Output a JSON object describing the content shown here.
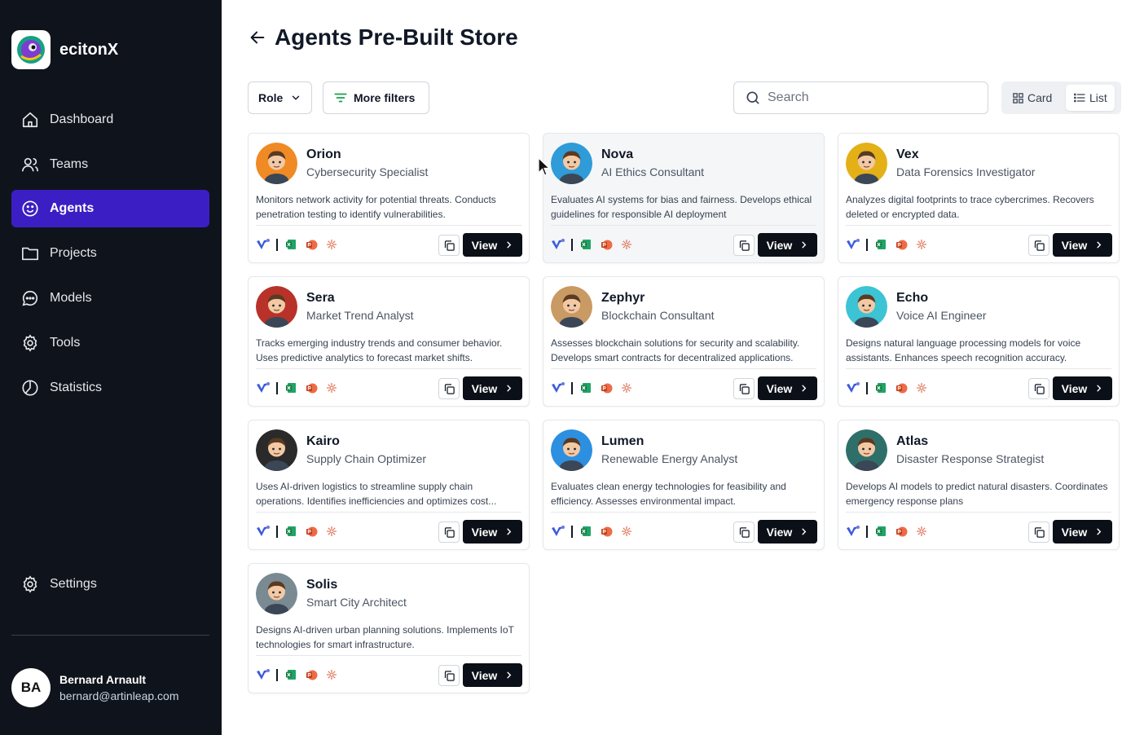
{
  "app": {
    "name": "ecitonX"
  },
  "sidebar": {
    "items": [
      {
        "label": "Dashboard",
        "icon": "home-icon"
      },
      {
        "label": "Teams",
        "icon": "users-icon"
      },
      {
        "label": "Agents",
        "icon": "smile-icon",
        "active": true
      },
      {
        "label": "Projects",
        "icon": "folder-icon"
      },
      {
        "label": "Models",
        "icon": "chat-icon"
      },
      {
        "label": "Tools",
        "icon": "gear-icon"
      },
      {
        "label": "Statistics",
        "icon": "pie-chart-icon"
      }
    ],
    "settings_label": "Settings"
  },
  "user": {
    "initials": "BA",
    "name": "Bernard Arnault",
    "email": "bernard@artinleap.com"
  },
  "page": {
    "title": "Agents Pre-Built Store"
  },
  "filters": {
    "role_label": "Role",
    "more_filters_label": "More filters"
  },
  "search": {
    "placeholder": "Search"
  },
  "view_toggle": {
    "card_label": "Card",
    "list_label": "List",
    "selected": "List"
  },
  "card_action": {
    "view_label": "View"
  },
  "colors": {
    "accent": "#3b1fc4",
    "sidebar_bg": "#0f141c",
    "view_button": "#0b0f17"
  },
  "agents": [
    {
      "name": "Orion",
      "role": "Cybersecurity Specialist",
      "description": "Monitors network activity for potential threats. Conducts penetration testing to identify vulnerabilities.",
      "avatar_color": "#f08a24"
    },
    {
      "name": "Nova",
      "role": "AI Ethics Consultant",
      "description": "Evaluates AI systems for bias and fairness. Develops ethical guidelines for responsible AI deployment",
      "avatar_color": "#2f9bd8"
    },
    {
      "name": "Vex",
      "role": "Data Forensics Investigator",
      "description": "Analyzes digital footprints to trace cybercrimes. Recovers deleted or encrypted data.",
      "avatar_color": "#e3b117"
    },
    {
      "name": "Sera",
      "role": "Market Trend Analyst",
      "description": "Tracks emerging industry trends and consumer behavior. Uses predictive analytics to forecast market shifts.",
      "avatar_color": "#b8322a"
    },
    {
      "name": "Zephyr",
      "role": "Blockchain Consultant",
      "description": "Assesses blockchain solutions for security and scalability. Develops smart contracts for decentralized applications.",
      "avatar_color": "#c99a63"
    },
    {
      "name": "Echo",
      "role": "Voice AI Engineer",
      "description": "Designs natural language processing models for voice assistants. Enhances speech recognition accuracy.",
      "avatar_color": "#3cc3d4"
    },
    {
      "name": "Kairo",
      "role": "Supply Chain Optimizer",
      "description": "Uses AI-driven logistics to streamline supply chain operations. Identifies inefficiencies and optimizes cost...",
      "avatar_color": "#2a2a2a"
    },
    {
      "name": "Lumen",
      "role": "Renewable Energy Analyst",
      "description": "Evaluates clean energy technologies for feasibility and efficiency. Assesses environmental impact.",
      "avatar_color": "#2d8fe0"
    },
    {
      "name": "Atlas",
      "role": "Disaster Response Strategist",
      "description": "Develops AI models to predict natural disasters. Coordinates emergency response plans",
      "avatar_color": "#2f6f6a"
    },
    {
      "name": "Solis",
      "role": "Smart City Architect",
      "description": "Designs AI-driven urban planning solutions. Implements IoT technologies for smart infrastructure.",
      "avatar_color": "#7a8a92"
    }
  ],
  "card_tools": [
    "ai-logo-icon",
    "excel-icon",
    "powerpoint-icon",
    "openai-icon"
  ]
}
